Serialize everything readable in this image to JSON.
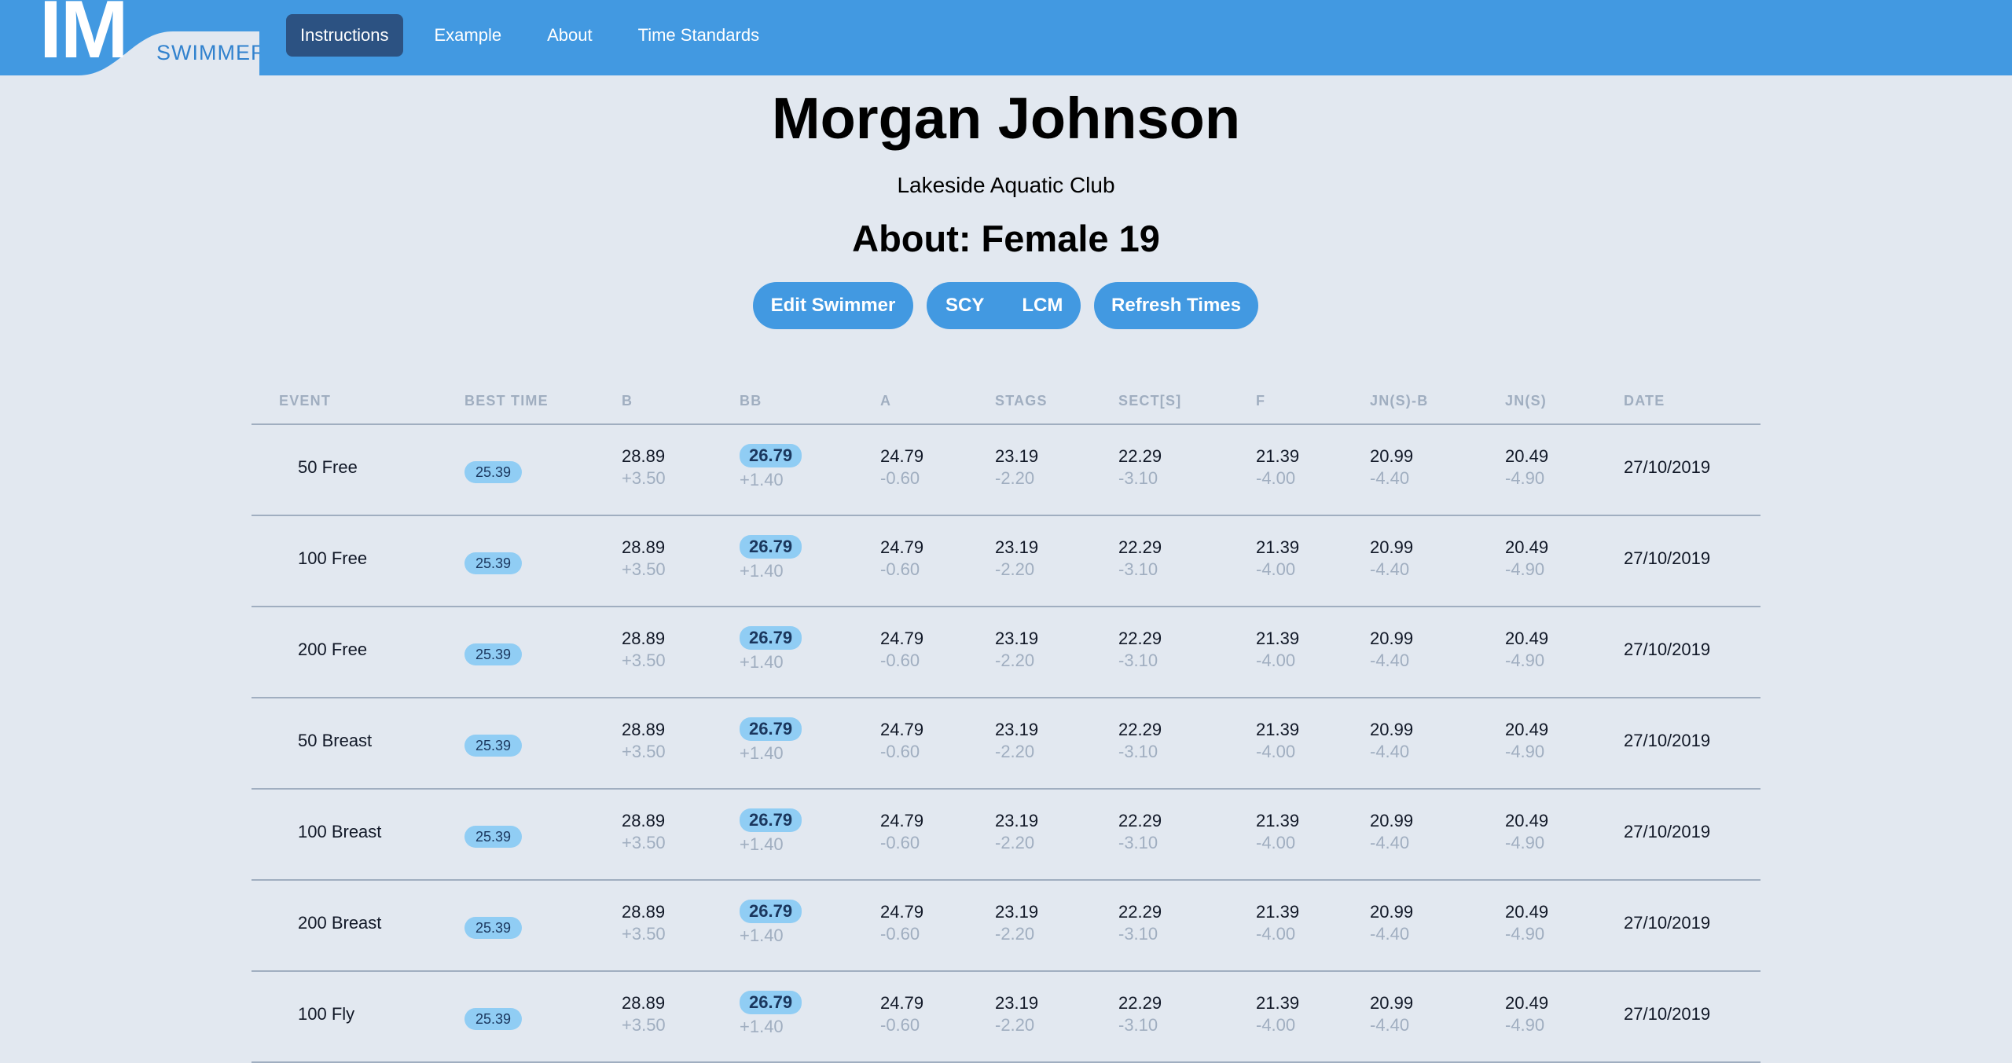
{
  "logo": {
    "letters": "IM",
    "word": "SWIMMER"
  },
  "nav": {
    "items": [
      {
        "label": "Instructions",
        "active": true
      },
      {
        "label": "Example"
      },
      {
        "label": "About"
      },
      {
        "label": "Time Standards"
      }
    ]
  },
  "swimmer": {
    "name": "Morgan Johnson",
    "club": "Lakeside Aquatic Club",
    "about": "About: Female 19"
  },
  "actions": {
    "edit": "Edit Swimmer",
    "course_scy": "SCY",
    "course_lcm": "LCM",
    "refresh": "Refresh Times"
  },
  "table": {
    "headers": [
      "EVENT",
      "BEST TIME",
      "B",
      "BB",
      "A",
      "STAGS",
      "SECT[S]",
      "F",
      "JN(S)-B",
      "JN(S)",
      "DATE"
    ],
    "rows": [
      {
        "event": "50 Free",
        "best": "25.39",
        "standards": [
          [
            "28.89",
            "+3.50"
          ],
          [
            "26.79",
            "+1.40"
          ],
          [
            "24.79",
            "-0.60"
          ],
          [
            "23.19",
            "-2.20"
          ],
          [
            "22.29",
            "-3.10"
          ],
          [
            "21.39",
            "-4.00"
          ],
          [
            "20.99",
            "-4.40"
          ],
          [
            "20.49",
            "-4.90"
          ]
        ],
        "date": "27/10/2019"
      },
      {
        "event": "100 Free",
        "best": "25.39",
        "standards": [
          [
            "28.89",
            "+3.50"
          ],
          [
            "26.79",
            "+1.40"
          ],
          [
            "24.79",
            "-0.60"
          ],
          [
            "23.19",
            "-2.20"
          ],
          [
            "22.29",
            "-3.10"
          ],
          [
            "21.39",
            "-4.00"
          ],
          [
            "20.99",
            "-4.40"
          ],
          [
            "20.49",
            "-4.90"
          ]
        ],
        "date": "27/10/2019"
      },
      {
        "event": "200 Free",
        "best": "25.39",
        "standards": [
          [
            "28.89",
            "+3.50"
          ],
          [
            "26.79",
            "+1.40"
          ],
          [
            "24.79",
            "-0.60"
          ],
          [
            "23.19",
            "-2.20"
          ],
          [
            "22.29",
            "-3.10"
          ],
          [
            "21.39",
            "-4.00"
          ],
          [
            "20.99",
            "-4.40"
          ],
          [
            "20.49",
            "-4.90"
          ]
        ],
        "date": "27/10/2019"
      },
      {
        "event": "50 Breast",
        "best": "25.39",
        "standards": [
          [
            "28.89",
            "+3.50"
          ],
          [
            "26.79",
            "+1.40"
          ],
          [
            "24.79",
            "-0.60"
          ],
          [
            "23.19",
            "-2.20"
          ],
          [
            "22.29",
            "-3.10"
          ],
          [
            "21.39",
            "-4.00"
          ],
          [
            "20.99",
            "-4.40"
          ],
          [
            "20.49",
            "-4.90"
          ]
        ],
        "date": "27/10/2019"
      },
      {
        "event": "100 Breast",
        "best": "25.39",
        "standards": [
          [
            "28.89",
            "+3.50"
          ],
          [
            "26.79",
            "+1.40"
          ],
          [
            "24.79",
            "-0.60"
          ],
          [
            "23.19",
            "-2.20"
          ],
          [
            "22.29",
            "-3.10"
          ],
          [
            "21.39",
            "-4.00"
          ],
          [
            "20.99",
            "-4.40"
          ],
          [
            "20.49",
            "-4.90"
          ]
        ],
        "date": "27/10/2019"
      },
      {
        "event": "200 Breast",
        "best": "25.39",
        "standards": [
          [
            "28.89",
            "+3.50"
          ],
          [
            "26.79",
            "+1.40"
          ],
          [
            "24.79",
            "-0.60"
          ],
          [
            "23.19",
            "-2.20"
          ],
          [
            "22.29",
            "-3.10"
          ],
          [
            "21.39",
            "-4.00"
          ],
          [
            "20.99",
            "-4.40"
          ],
          [
            "20.49",
            "-4.90"
          ]
        ],
        "date": "27/10/2019"
      },
      {
        "event": "100 Fly",
        "best": "25.39",
        "standards": [
          [
            "28.89",
            "+3.50"
          ],
          [
            "26.79",
            "+1.40"
          ],
          [
            "24.79",
            "-0.60"
          ],
          [
            "23.19",
            "-2.20"
          ],
          [
            "22.29",
            "-3.10"
          ],
          [
            "21.39",
            "-4.00"
          ],
          [
            "20.99",
            "-4.40"
          ],
          [
            "20.49",
            "-4.90"
          ]
        ],
        "date": "27/10/2019"
      }
    ]
  },
  "colors": {
    "topbar": "#4299e1",
    "nav_active": "#2c5282",
    "page_bg": "#e2e8f0",
    "highlight_pill": "#90cdf4",
    "muted_text": "#a0aec0"
  }
}
